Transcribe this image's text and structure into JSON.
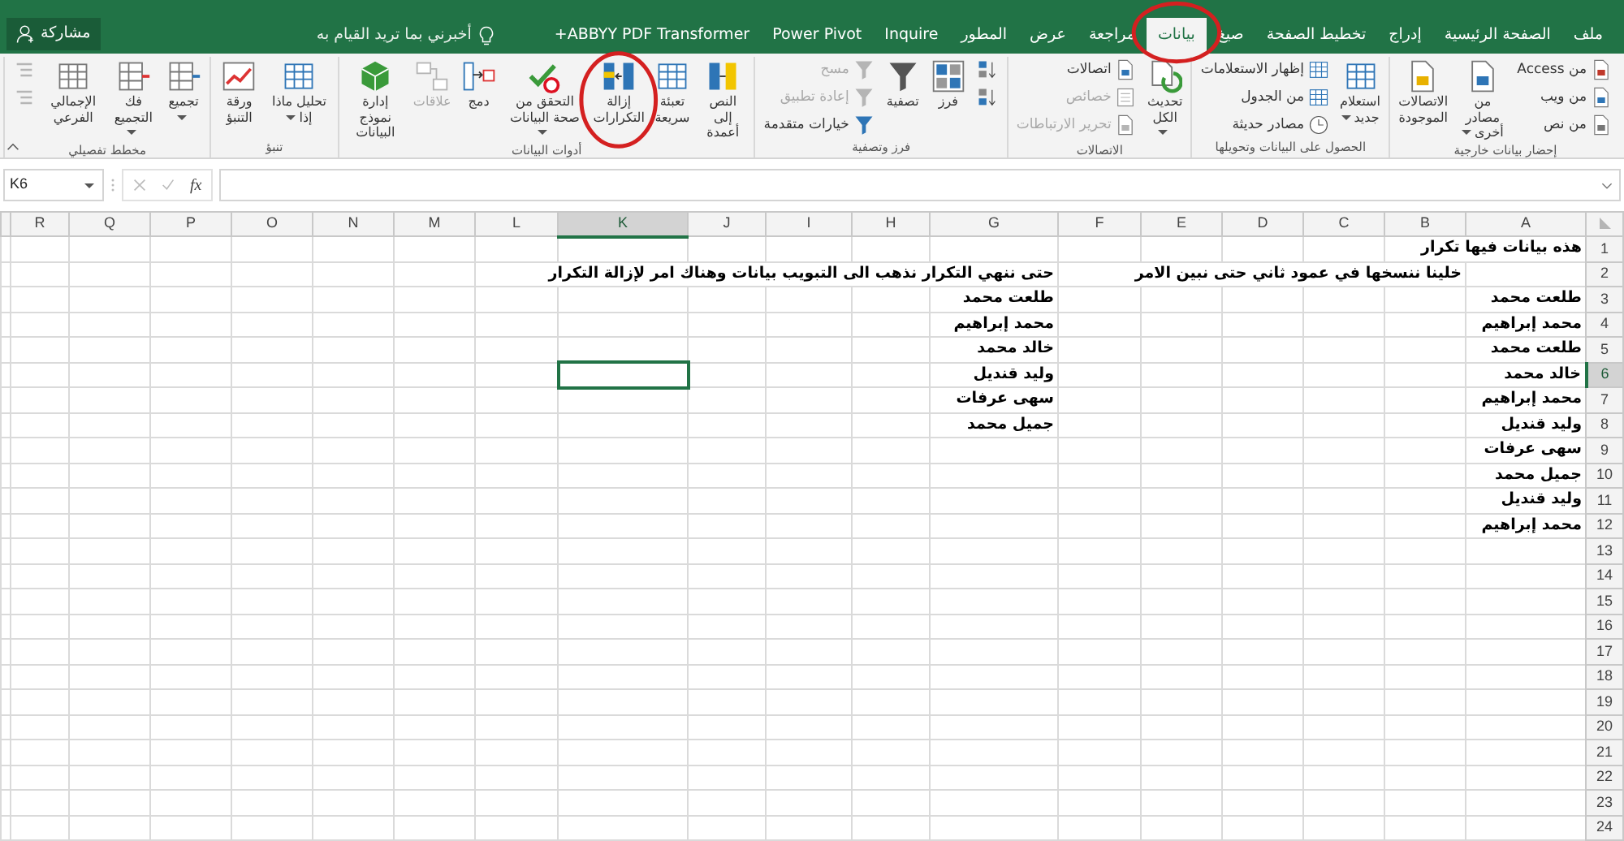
{
  "tabs": [
    {
      "label": "ملف",
      "selected": false
    },
    {
      "label": "الصفحة الرئيسية",
      "selected": false
    },
    {
      "label": "إدراج",
      "selected": false
    },
    {
      "label": "تخطيط الصفحة",
      "selected": false
    },
    {
      "label": "صيغ",
      "selected": false
    },
    {
      "label": "بيانات",
      "selected": true
    },
    {
      "label": "مراجعة",
      "selected": false
    },
    {
      "label": "عرض",
      "selected": false
    },
    {
      "label": "المطور",
      "selected": false
    },
    {
      "label": "Inquire",
      "selected": false
    },
    {
      "label": "Power Pivot",
      "selected": false
    },
    {
      "label": "ABBYY PDF Transformer+",
      "selected": false
    }
  ],
  "tell_me": {
    "placeholder": "أخبرني بما تريد القيام به"
  },
  "share_button": {
    "label": "مشاركة"
  },
  "ribbon_groups": [
    {
      "label": "إحضار بيانات خارجية",
      "commands": [
        {
          "kind": "small",
          "label": "من Access",
          "disabled": false,
          "dropdown": false
        },
        {
          "kind": "small",
          "label": "من ويب",
          "disabled": false,
          "dropdown": false
        },
        {
          "kind": "small",
          "label": "من نص",
          "disabled": false,
          "dropdown": false
        },
        {
          "kind": "large",
          "label": "من مصادر أخرى",
          "disabled": false,
          "dropdown": true
        },
        {
          "kind": "large",
          "label": "الاتصالات الموجودة",
          "disabled": false,
          "dropdown": false
        }
      ]
    },
    {
      "label": "الحصول على البيانات وتحويلها",
      "commands": [
        {
          "kind": "large",
          "label": "استعلام جديد",
          "disabled": false,
          "dropdown": true
        },
        {
          "kind": "small",
          "label": "إظهار الاستعلامات",
          "disabled": false,
          "dropdown": false
        },
        {
          "kind": "small",
          "label": "من الجدول",
          "disabled": false,
          "dropdown": false
        },
        {
          "kind": "small",
          "label": "مصادر حديثة",
          "disabled": false,
          "dropdown": false
        }
      ]
    },
    {
      "label": "الاتصالات",
      "commands": [
        {
          "kind": "large",
          "label": "تحديث الكل",
          "disabled": false,
          "dropdown": true
        },
        {
          "kind": "small",
          "label": "اتصالات",
          "disabled": false,
          "dropdown": false
        },
        {
          "kind": "small",
          "label": "خصائص",
          "disabled": true,
          "dropdown": false
        },
        {
          "kind": "small",
          "label": "تحرير الارتباطات",
          "disabled": true,
          "dropdown": false
        }
      ]
    },
    {
      "label": "فرز وتصفية",
      "commands": [
        {
          "kind": "icon",
          "disabled": false,
          "dropdown": false
        },
        {
          "kind": "icon",
          "disabled": false,
          "dropdown": false
        },
        {
          "kind": "large",
          "label": "فرز",
          "disabled": false,
          "dropdown": false
        },
        {
          "kind": "large",
          "label": "تصفية",
          "disabled": false,
          "dropdown": false
        },
        {
          "kind": "small",
          "label": "مسح",
          "disabled": true,
          "dropdown": false
        },
        {
          "kind": "small",
          "label": "إعادة تطبيق",
          "disabled": true,
          "dropdown": false
        },
        {
          "kind": "small",
          "label": "خيارات متقدمة",
          "disabled": false,
          "dropdown": false
        }
      ]
    },
    {
      "label": "أدوات البيانات",
      "commands": [
        {
          "kind": "large",
          "label": "النص إلى أعمدة",
          "disabled": false,
          "dropdown": false
        },
        {
          "kind": "large",
          "label": "تعبئة سريعة",
          "disabled": false,
          "dropdown": false
        },
        {
          "kind": "large",
          "label": "إزالة التكرارات",
          "disabled": false,
          "dropdown": false
        },
        {
          "kind": "large",
          "label": "التحقق من صحة البيانات",
          "disabled": false,
          "dropdown": true
        },
        {
          "kind": "large",
          "label": "دمج",
          "disabled": false,
          "dropdown": false
        },
        {
          "kind": "large",
          "label": "علاقات",
          "disabled": true,
          "dropdown": false
        },
        {
          "kind": "large",
          "label": "إدارة نموذج البيانات",
          "disabled": false,
          "dropdown": false
        }
      ]
    },
    {
      "label": "تنبؤ",
      "commands": [
        {
          "kind": "large",
          "label": "تحليل ماذا إذا",
          "disabled": false,
          "dropdown": true
        },
        {
          "kind": "large",
          "label": "ورقة التنبؤ",
          "disabled": false,
          "dropdown": false
        }
      ]
    },
    {
      "label": "مخطط تفصيلي",
      "commands": [
        {
          "kind": "large",
          "label": "تجميع",
          "disabled": false,
          "dropdown": true
        },
        {
          "kind": "large",
          "label": "فك التجميع",
          "disabled": false,
          "dropdown": true
        },
        {
          "kind": "large",
          "label": "الإجمالي الفرعي",
          "disabled": false,
          "dropdown": false
        },
        {
          "kind": "icon",
          "disabled": true,
          "dropdown": false
        },
        {
          "kind": "icon",
          "disabled": true,
          "dropdown": false
        }
      ]
    }
  ],
  "name_box": {
    "value": "K6"
  },
  "formula_bar": {
    "function_label": "fx"
  },
  "columns": [
    {
      "label": "A",
      "selected": false
    },
    {
      "label": "B",
      "selected": false
    },
    {
      "label": "C",
      "selected": false
    },
    {
      "label": "D",
      "selected": false
    },
    {
      "label": "E",
      "selected": false
    },
    {
      "label": "F",
      "selected": false
    },
    {
      "label": "G",
      "selected": false
    },
    {
      "label": "H",
      "selected": false
    },
    {
      "label": "I",
      "selected": false
    },
    {
      "label": "J",
      "selected": false
    },
    {
      "label": "K",
      "selected": true
    },
    {
      "label": "L",
      "selected": false
    },
    {
      "label": "M",
      "selected": false
    },
    {
      "label": "N",
      "selected": false
    },
    {
      "label": "O",
      "selected": false
    },
    {
      "label": "P",
      "selected": false
    },
    {
      "label": "Q",
      "selected": false
    },
    {
      "label": "R",
      "selected": false
    }
  ],
  "rows": [
    {
      "number": "1",
      "selected": false,
      "cells": {
        "A": "هذه بيانات فيها تكرار"
      }
    },
    {
      "number": "2",
      "selected": false,
      "cells": {
        "B": "خلينا ننسخها في عمود ثاني حتى نبين الامر",
        "G": "حتى ننهي التكرار نذهب الى التبويب بيانات وهناك امر لإزالة التكرار"
      }
    },
    {
      "number": "3",
      "selected": false,
      "cells": {
        "A": "طلعت محمد",
        "G": "طلعت محمد"
      }
    },
    {
      "number": "4",
      "selected": false,
      "cells": {
        "A": "محمد إبراهيم",
        "G": "محمد إبراهيم"
      }
    },
    {
      "number": "5",
      "selected": false,
      "cells": {
        "A": "طلعت محمد",
        "G": "خالد محمد"
      }
    },
    {
      "number": "6",
      "selected": true,
      "cells": {
        "A": "خالد محمد",
        "G": "وليد قنديل"
      }
    },
    {
      "number": "7",
      "selected": false,
      "cells": {
        "A": "محمد إبراهيم",
        "G": "سهى عرفات"
      }
    },
    {
      "number": "8",
      "selected": false,
      "cells": {
        "A": "وليد قنديل",
        "G": "جميل محمد"
      }
    },
    {
      "number": "9",
      "selected": false,
      "cells": {
        "A": "سهى عرفات"
      }
    },
    {
      "number": "10",
      "selected": false,
      "cells": {
        "A": "جميل محمد"
      }
    },
    {
      "number": "11",
      "selected": false,
      "cells": {
        "A": "وليد قنديل"
      }
    },
    {
      "number": "12",
      "selected": false,
      "cells": {
        "A": "محمد إبراهيم"
      }
    },
    {
      "number": "13",
      "selected": false,
      "cells": {}
    },
    {
      "number": "14",
      "selected": false,
      "cells": {}
    },
    {
      "number": "15",
      "selected": false,
      "cells": {}
    },
    {
      "number": "16",
      "selected": false,
      "cells": {}
    },
    {
      "number": "17",
      "selected": false,
      "cells": {}
    },
    {
      "number": "18",
      "selected": false,
      "cells": {}
    },
    {
      "number": "19",
      "selected": false,
      "cells": {}
    },
    {
      "number": "20",
      "selected": false,
      "cells": {}
    },
    {
      "number": "21",
      "selected": false,
      "cells": {}
    },
    {
      "number": "22",
      "selected": false,
      "cells": {}
    },
    {
      "number": "23",
      "selected": false,
      "cells": {}
    },
    {
      "number": "24",
      "selected": false,
      "cells": {}
    }
  ]
}
